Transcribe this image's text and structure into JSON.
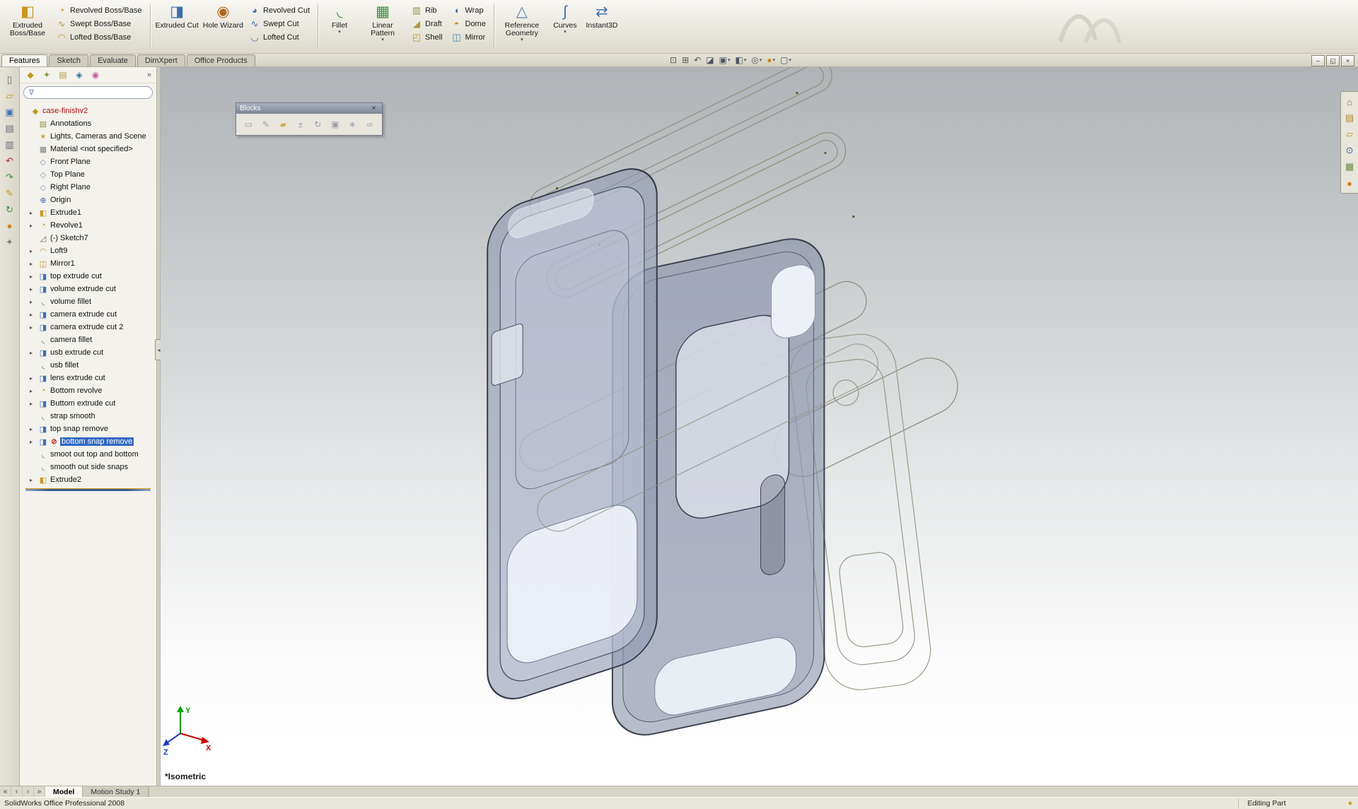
{
  "window": {
    "status_left": "SolidWorks Office Professional 2008",
    "status_right": "Editing Part"
  },
  "main_tabs": [
    {
      "label": "Features",
      "active": true
    },
    {
      "label": "Sketch"
    },
    {
      "label": "Evaluate"
    },
    {
      "label": "DimXpert"
    },
    {
      "label": "Office Products"
    }
  ],
  "ribbon_cells": [
    {
      "type": "big",
      "label": "Extruded Boss/Base",
      "icon": "extruded-boss-icon"
    },
    {
      "type": "col",
      "buttons": [
        {
          "label": "Revolved Boss/Base",
          "icon": "revolved-boss-icon"
        },
        {
          "label": "Swept Boss/Base",
          "icon": "swept-boss-icon"
        },
        {
          "label": "Lofted Boss/Base",
          "icon": "lofted-boss-icon"
        }
      ]
    },
    {
      "type": "sep"
    },
    {
      "type": "big",
      "label": "Extruded Cut",
      "icon": "extruded-cut-icon"
    },
    {
      "type": "big",
      "label": "Hole Wizard",
      "icon": "hole-wizard-icon"
    },
    {
      "type": "col",
      "buttons": [
        {
          "label": "Revolved Cut",
          "icon": "revolved-cut-icon"
        },
        {
          "label": "Swept Cut",
          "icon": "swept-cut-icon"
        },
        {
          "label": "Lofted Cut",
          "icon": "lofted-cut-icon"
        }
      ]
    },
    {
      "type": "sep"
    },
    {
      "type": "big",
      "label": "Fillet",
      "icon": "fillet-icon",
      "arrow": true
    },
    {
      "type": "big",
      "label": "Linear Pattern",
      "icon": "linear-pattern-icon",
      "arrow": true
    },
    {
      "type": "col",
      "buttons": [
        {
          "label": "Rib",
          "icon": "rib-icon"
        },
        {
          "label": "Draft",
          "icon": "draft-icon"
        },
        {
          "label": "Shell",
          "icon": "shell-icon"
        }
      ]
    },
    {
      "type": "col",
      "buttons": [
        {
          "label": "Wrap",
          "icon": "wrap-icon"
        },
        {
          "label": "Dome",
          "icon": "dome-icon"
        },
        {
          "label": "Mirror",
          "icon": "mirror-icon"
        }
      ]
    },
    {
      "type": "sep"
    },
    {
      "type": "big",
      "label": "Reference Geometry",
      "icon": "reference-geometry-icon",
      "arrow": true
    },
    {
      "type": "big",
      "label": "Curves",
      "icon": "curves-icon",
      "arrow": true
    },
    {
      "type": "big",
      "label": "Instant3D",
      "icon": "instant3d-icon"
    }
  ],
  "left_toolbar": [
    {
      "icon": "new-document-icon"
    },
    {
      "icon": "open-icon"
    },
    {
      "icon": "save-icon"
    },
    {
      "icon": "print-icon"
    },
    {
      "icon": "print-preview-icon"
    },
    {
      "icon": "undo-icon"
    },
    {
      "icon": "redo-icon"
    },
    {
      "icon": "edit-sketch-icon"
    },
    {
      "icon": "rebuild-icon"
    },
    {
      "icon": "appearance-icon"
    },
    {
      "icon": "options-icon"
    }
  ],
  "feature_tree": {
    "tabs": [
      {
        "icon": "featuremanager-tab-icon"
      },
      {
        "icon": "propertymanager-tab-icon"
      },
      {
        "icon": "configurationmanager-tab-icon"
      },
      {
        "icon": "dimxpertmanager-tab-icon"
      },
      {
        "icon": "displaymanager-tab-icon"
      }
    ],
    "overflow_label": "»",
    "filter_value": "",
    "items": [
      {
        "label": "case-finishv2",
        "icon": "part-icon",
        "color": "#b01010",
        "root": true
      },
      {
        "label": "Annotations",
        "icon": "annotations-icon"
      },
      {
        "label": "Lights, Cameras and Scene",
        "icon": "lights-icon"
      },
      {
        "label": "Material <not specified>",
        "icon": "material-icon"
      },
      {
        "label": "Front Plane",
        "icon": "plane-icon"
      },
      {
        "label": "Top Plane",
        "icon": "plane-icon"
      },
      {
        "label": "Right Plane",
        "icon": "plane-icon"
      },
      {
        "label": "Origin",
        "icon": "origin-icon"
      },
      {
        "label": "Extrude1",
        "icon": "extrude-boss-icon",
        "arrow": true
      },
      {
        "label": "Revolve1",
        "icon": "revolve-feature-icon",
        "arrow": true
      },
      {
        "label": "(-) Sketch7",
        "icon": "sketch-icon"
      },
      {
        "label": "Loft9",
        "icon": "loft-icon",
        "arrow": true
      },
      {
        "label": "Mirror1",
        "icon": "mirror-feature-icon",
        "arrow": true
      },
      {
        "label": "top extrude cut",
        "icon": "extrude-cut-icon",
        "arrow": true
      },
      {
        "label": "volume extrude cut",
        "icon": "extrude-cut-icon",
        "arrow": true
      },
      {
        "label": "volume fillet",
        "icon": "fillet-feature-icon",
        "arrow": true
      },
      {
        "label": "camera extrude cut",
        "icon": "extrude-cut-icon",
        "arrow": true
      },
      {
        "label": "camera extrude cut 2",
        "icon": "extrude-cut-icon",
        "arrow": true
      },
      {
        "label": "camera fillet",
        "icon": "fillet-feature-icon"
      },
      {
        "label": "usb extrude cut",
        "icon": "extrude-cut-icon",
        "arrow": true
      },
      {
        "label": "usb fillet",
        "icon": "fillet-feature-icon"
      },
      {
        "label": "lens extrude cut",
        "icon": "extrude-cut-icon",
        "arrow": true
      },
      {
        "label": "Bottom revolve",
        "icon": "revolve-feature-icon",
        "arrow": true
      },
      {
        "label": "Buttom extrude cut",
        "icon": "extrude-cut-icon",
        "arrow": true
      },
      {
        "label": "strap smooth",
        "icon": "fillet-feature-icon"
      },
      {
        "label": "top snap remove",
        "icon": "extrude-cut-icon",
        "arrow": true
      },
      {
        "label": "bottom snap remove",
        "icon": "extrude-cut-icon",
        "badge": "error-icon",
        "arrow": true,
        "selected": true
      },
      {
        "label": "smoot out top and bottom",
        "icon": "fillet-feature-icon"
      },
      {
        "label": "smooth out side snaps",
        "icon": "fillet-feature-icon"
      },
      {
        "label": "Extrude2",
        "icon": "extrude-boss-icon",
        "arrow": true
      }
    ]
  },
  "blocks_toolbar": {
    "title": "Blocks",
    "buttons": [
      {
        "icon": "make-block-icon"
      },
      {
        "icon": "edit-block-icon"
      },
      {
        "icon": "insert-block-icon"
      },
      {
        "icon": "add-remove-entities-icon"
      },
      {
        "icon": "rebuild-block-icon"
      },
      {
        "icon": "save-block-icon"
      },
      {
        "icon": "explode-block-icon"
      },
      {
        "icon": "belt-chain-icon"
      }
    ]
  },
  "viewport": {
    "hud_icons": [
      {
        "icon": "zoom-fit-icon"
      },
      {
        "icon": "zoom-area-icon"
      },
      {
        "icon": "previous-view-icon"
      },
      {
        "icon": "section-view-icon"
      },
      {
        "icon": "view-orientation-icon",
        "arrow": true
      },
      {
        "icon": "display-style-icon",
        "arrow": true
      },
      {
        "icon": "hide-show-items-icon",
        "arrow": true
      },
      {
        "icon": "edit-appearance-icon",
        "arrow": true
      },
      {
        "icon": "apply-scene-icon",
        "arrow": true
      }
    ],
    "view_label": "*Isometric",
    "triad": {
      "x": "X",
      "y": "Y",
      "z": "Z"
    }
  },
  "task_pane_tabs": [
    {
      "icon": "solidworks-resources-icon"
    },
    {
      "icon": "design-library-icon"
    },
    {
      "icon": "file-explorer-icon"
    },
    {
      "icon": "search-icon"
    },
    {
      "icon": "view-palette-icon"
    },
    {
      "icon": "appearances-icon"
    }
  ],
  "bottom_bar": {
    "nav": [
      {
        "icon": "first-tab-icon"
      },
      {
        "icon": "prev-tab-icon"
      },
      {
        "icon": "next-tab-icon"
      },
      {
        "icon": "last-tab-icon"
      }
    ],
    "tabs": [
      {
        "label": "Model",
        "active": true
      },
      {
        "label": "Motion Study 1"
      }
    ]
  },
  "window_controls": [
    {
      "icon": "minimize-icon"
    },
    {
      "icon": "restore-icon"
    },
    {
      "icon": "close-icon"
    }
  ]
}
